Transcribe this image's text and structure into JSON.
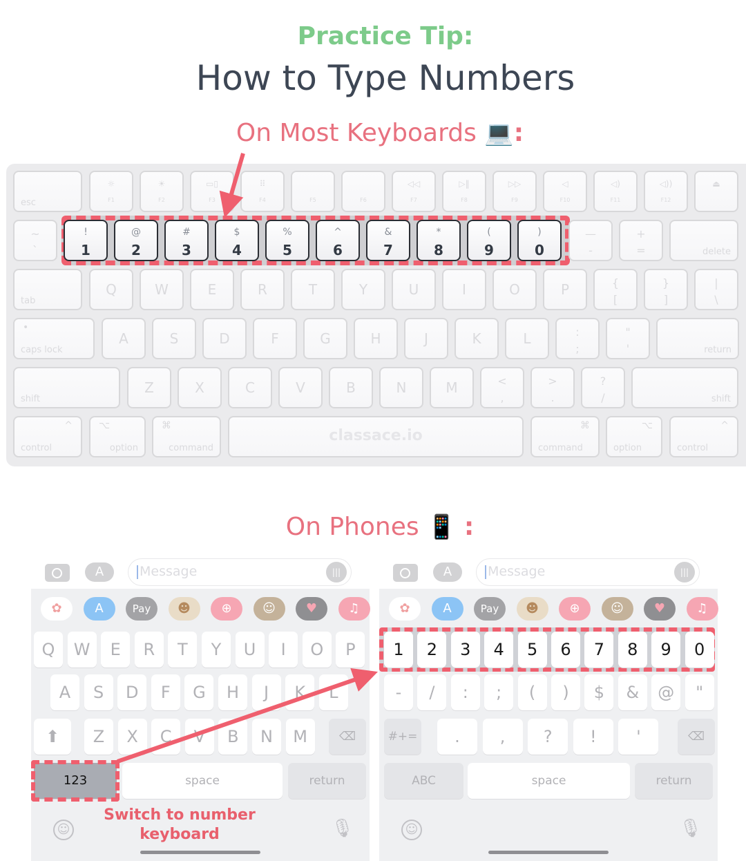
{
  "header": {
    "tip": "Practice Tip:",
    "title": "How to Type Numbers",
    "keyboard_section": "On Most Keyboards",
    "keyboard_emoji": "💻",
    "phone_section": "On Phones",
    "phone_emoji": "📱",
    "colon": ":"
  },
  "colors": {
    "accent_green": "#7dcb8a",
    "accent_red": "#ef5f6e",
    "title": "#3d4654"
  },
  "mac_keyboard": {
    "row_fn": [
      {
        "label": "esc"
      },
      {
        "icon": "☼",
        "label": "F1"
      },
      {
        "icon": "☀",
        "label": "F2"
      },
      {
        "icon": "▭▯",
        "label": "F3"
      },
      {
        "icon": "⠿",
        "label": "F4"
      },
      {
        "icon": "",
        "label": "F5"
      },
      {
        "icon": "",
        "label": "F6"
      },
      {
        "icon": "◁◁",
        "label": "F7"
      },
      {
        "icon": "▷‖",
        "label": "F8"
      },
      {
        "icon": "▷▷",
        "label": "F9"
      },
      {
        "icon": "◁",
        "label": "F10"
      },
      {
        "icon": "◁)",
        "label": "F11"
      },
      {
        "icon": "◁))",
        "label": "F12"
      },
      {
        "icon": "⏏",
        "label": ""
      }
    ],
    "row_num": [
      {
        "up": "~",
        "lo": "`"
      },
      {
        "up": "!",
        "lo": "1"
      },
      {
        "up": "@",
        "lo": "2"
      },
      {
        "up": "#",
        "lo": "3"
      },
      {
        "up": "$",
        "lo": "4"
      },
      {
        "up": "%",
        "lo": "5"
      },
      {
        "up": "^",
        "lo": "6"
      },
      {
        "up": "&",
        "lo": "7"
      },
      {
        "up": "*",
        "lo": "8"
      },
      {
        "up": "(",
        "lo": "9"
      },
      {
        "up": ")",
        "lo": "0"
      },
      {
        "up": "—",
        "lo": "-"
      },
      {
        "up": "+",
        "lo": "="
      },
      {
        "label": "delete"
      }
    ],
    "row_q": [
      {
        "label": "tab"
      },
      {
        "c": "Q"
      },
      {
        "c": "W"
      },
      {
        "c": "E"
      },
      {
        "c": "R"
      },
      {
        "c": "T"
      },
      {
        "c": "Y"
      },
      {
        "c": "U"
      },
      {
        "c": "I"
      },
      {
        "c": "O"
      },
      {
        "c": "P"
      },
      {
        "up": "{",
        "lo": "["
      },
      {
        "up": "}",
        "lo": "]"
      },
      {
        "up": "|",
        "lo": "\\"
      }
    ],
    "row_a": [
      {
        "label": "caps lock",
        "dot": "•"
      },
      {
        "c": "A"
      },
      {
        "c": "S"
      },
      {
        "c": "D"
      },
      {
        "c": "F"
      },
      {
        "c": "G"
      },
      {
        "c": "H"
      },
      {
        "c": "J"
      },
      {
        "c": "K"
      },
      {
        "c": "L"
      },
      {
        "up": ":",
        "lo": ";"
      },
      {
        "up": "\"",
        "lo": "'"
      },
      {
        "label": "return"
      }
    ],
    "row_z": [
      {
        "label": "shift"
      },
      {
        "c": "Z"
      },
      {
        "c": "X"
      },
      {
        "c": "C"
      },
      {
        "c": "V"
      },
      {
        "c": "B"
      },
      {
        "c": "N"
      },
      {
        "c": "M"
      },
      {
        "up": "<",
        "lo": ","
      },
      {
        "up": ">",
        "lo": "."
      },
      {
        "up": "?",
        "lo": "/"
      },
      {
        "label": "shift"
      }
    ],
    "row_mod": [
      {
        "label": "control",
        "sym": "^"
      },
      {
        "label": "option",
        "sym": "⌥"
      },
      {
        "label": "command",
        "sym": "⌘"
      },
      {
        "label": "classace.io"
      },
      {
        "label": "command",
        "sym": "⌘"
      },
      {
        "label": "option",
        "sym": "⌥"
      },
      {
        "label": "control",
        "sym": "^"
      }
    ]
  },
  "phone_common": {
    "message_placeholder": "Message",
    "apps": [
      {
        "name": "photos",
        "glyph": "✿",
        "color": "#ffffff",
        "fg": "#f0a0a0"
      },
      {
        "name": "app-store",
        "glyph": "A",
        "color": "#8cc4f5",
        "fg": "#ffffff"
      },
      {
        "name": "apple-pay",
        "glyph": "Pay",
        "color": "#a3a3a6",
        "fg": "#ffffff"
      },
      {
        "name": "memoji-stickers",
        "glyph": "☻",
        "color": "#e9dcc7",
        "fg": "#b58a5e"
      },
      {
        "name": "image-search",
        "glyph": "⊕",
        "color": "#f6a6b3",
        "fg": "#ffffff"
      },
      {
        "name": "memoji",
        "glyph": "☺",
        "color": "#c4b29a",
        "fg": "#ffffff"
      },
      {
        "name": "digital-touch",
        "glyph": "♥",
        "color": "#8f8f92",
        "fg": "#f6a6b3"
      },
      {
        "name": "music",
        "glyph": "♫",
        "color": "#f6a6b3",
        "fg": "#ffffff"
      }
    ],
    "space": "space",
    "return": "return"
  },
  "phone_letters": {
    "row1": [
      "Q",
      "W",
      "E",
      "R",
      "T",
      "Y",
      "U",
      "I",
      "O",
      "P"
    ],
    "row2": [
      "A",
      "S",
      "D",
      "F",
      "G",
      "H",
      "J",
      "K",
      "L"
    ],
    "row3": [
      "Z",
      "X",
      "C",
      "V",
      "B",
      "N",
      "M"
    ],
    "mode_key": "123",
    "annotation": "Switch to number keyboard"
  },
  "phone_numbers": {
    "row1": [
      "1",
      "2",
      "3",
      "4",
      "5",
      "6",
      "7",
      "8",
      "9",
      "0"
    ],
    "row2": [
      "-",
      "/",
      ":",
      ";",
      "(",
      ")",
      "$",
      "&",
      "@",
      "\""
    ],
    "row3": [
      ".",
      ",",
      "?",
      "!",
      "'"
    ],
    "symbols_key": "#+=",
    "mode_key": "ABC"
  }
}
